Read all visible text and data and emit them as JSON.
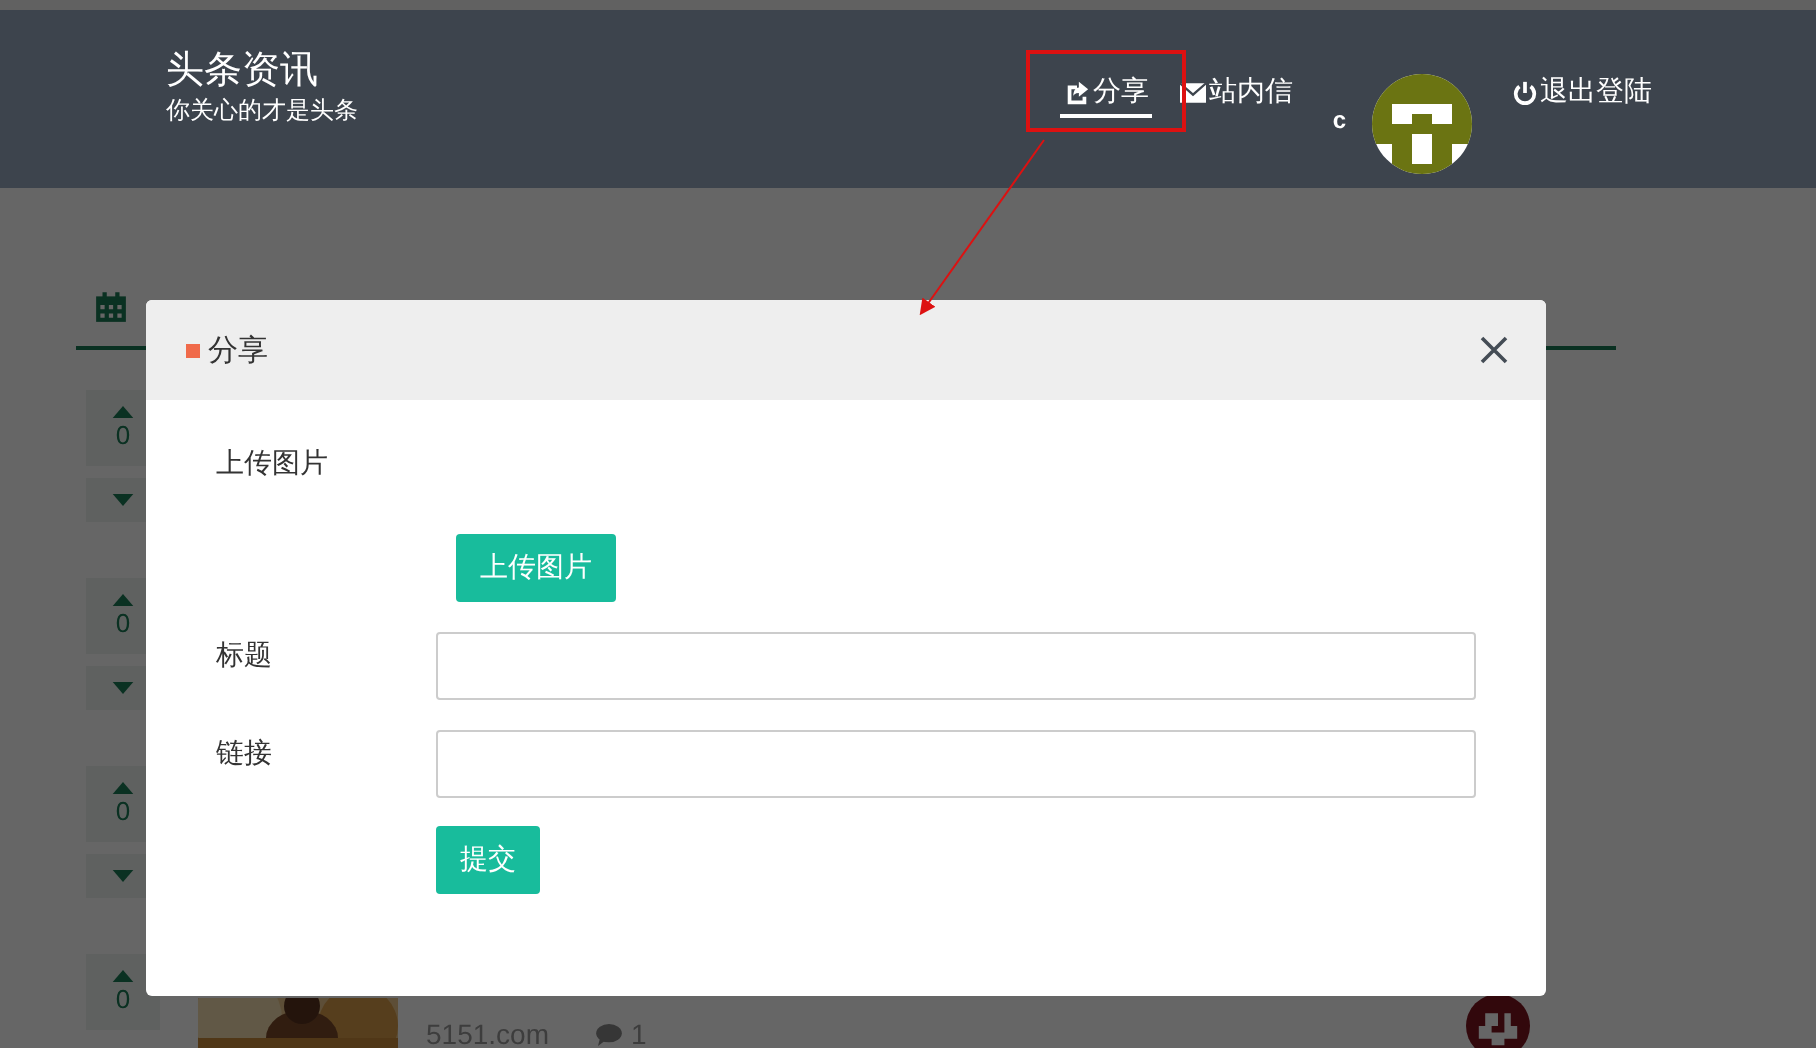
{
  "header": {
    "title": "头条资讯",
    "subtitle": "你关心的才是头条",
    "nav": [
      {
        "kind": "share",
        "label": "分享",
        "selected": true
      },
      {
        "kind": "mail",
        "label": "站内信",
        "selected": false
      }
    ],
    "username": "c",
    "logout": "退出登陆"
  },
  "posts": [
    {
      "votes": "0"
    },
    {
      "votes": "0"
    },
    {
      "votes": "0"
    },
    {
      "votes": "0",
      "source": "5151.com",
      "comments": "1"
    }
  ],
  "modal": {
    "title": "分享",
    "upload_label": "上传图片",
    "upload_button": "上传图片",
    "fields": [
      {
        "label": "标题"
      },
      {
        "label": "链接"
      }
    ],
    "submit": "提交"
  }
}
